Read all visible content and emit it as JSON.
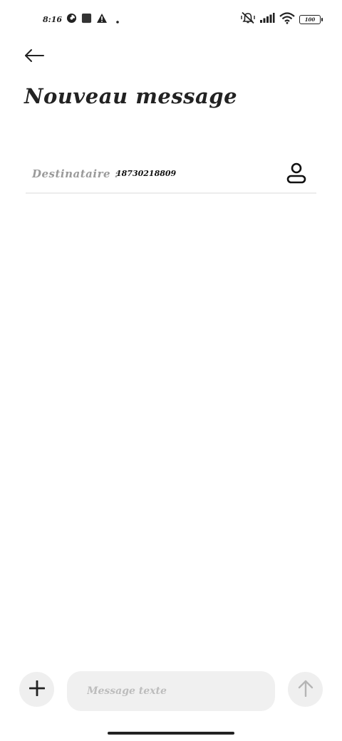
{
  "status_bar": {
    "time": "8:16",
    "battery_level": "100",
    "icons": [
      "data-saver-icon",
      "square-notification-icon",
      "warning-icon",
      "dot-icon",
      "vibrate-off-icon",
      "signal-icon",
      "wifi-icon",
      "battery-icon"
    ]
  },
  "header": {
    "title": "Nouveau message"
  },
  "recipient": {
    "label": "Destinataire :",
    "value": "18730218809"
  },
  "composer": {
    "placeholder": "Message texte"
  }
}
